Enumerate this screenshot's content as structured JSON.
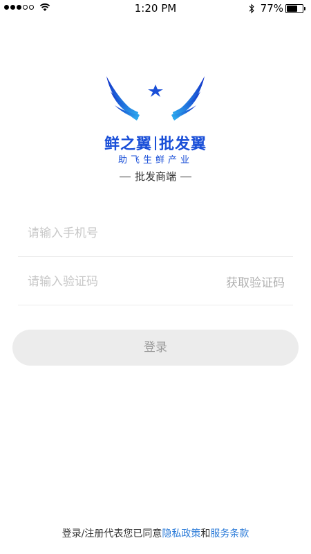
{
  "status_bar": {
    "time": "1:20 PM",
    "battery_text": "77%",
    "battery_level": 0.77,
    "signal": {
      "filled": 3,
      "total": 5
    }
  },
  "brand": {
    "logo_icon": "winged-logo-icon",
    "name_left": "鲜之翼",
    "name_right": "批发翼",
    "slogan": "助飞生鲜产业",
    "portal": "批发商端"
  },
  "form": {
    "phone_placeholder": "请输入手机号",
    "code_placeholder": "请输入验证码",
    "get_code_label": "获取验证码",
    "login_label": "登录"
  },
  "agreement": {
    "prefix": "登录/注册代表您已同意",
    "privacy_link": "隐私政策",
    "and": "和",
    "terms_link": "服务条款"
  },
  "colors": {
    "brand_blue": "#1a4fd8",
    "link_blue": "#2b7bd8",
    "button_bg": "#ececec"
  }
}
